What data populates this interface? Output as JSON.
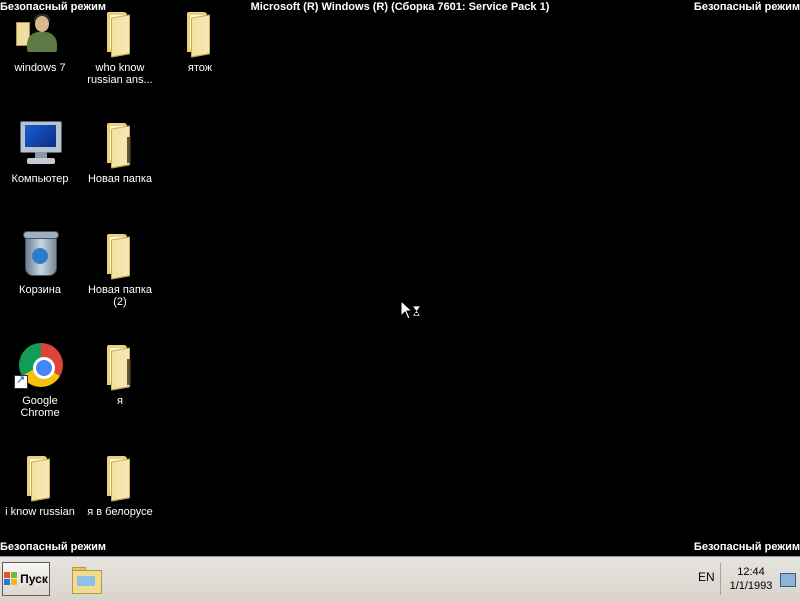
{
  "overlay": {
    "safe_mode_label": "Безопасный режим",
    "os_build": "Microsoft (R) Windows (R) (Сборка 7601: Service Pack 1)"
  },
  "desktop": {
    "icons": [
      {
        "label": "windows 7",
        "icon": "user-icon"
      },
      {
        "label": "who know russian ans...",
        "icon": "folder-icon"
      },
      {
        "label": "ятож",
        "icon": "folder-icon"
      },
      {
        "label": "Компьютер",
        "icon": "computer-icon"
      },
      {
        "label": "Новая папка",
        "icon": "folder-icon"
      },
      {
        "label": "Корзина",
        "icon": "recycle-bin-icon"
      },
      {
        "label": "Новая папка (2)",
        "icon": "folder-icon"
      },
      {
        "label": "Google Chrome",
        "icon": "chrome-icon"
      },
      {
        "label": "я",
        "icon": "folder-icon"
      },
      {
        "label": "i know russian",
        "icon": "folder-icon"
      },
      {
        "label": "я в белорусе",
        "icon": "folder-icon"
      }
    ]
  },
  "taskbar": {
    "start_label": "Пуск",
    "language": "EN",
    "time": "12:44",
    "date": "1/1/1993"
  }
}
